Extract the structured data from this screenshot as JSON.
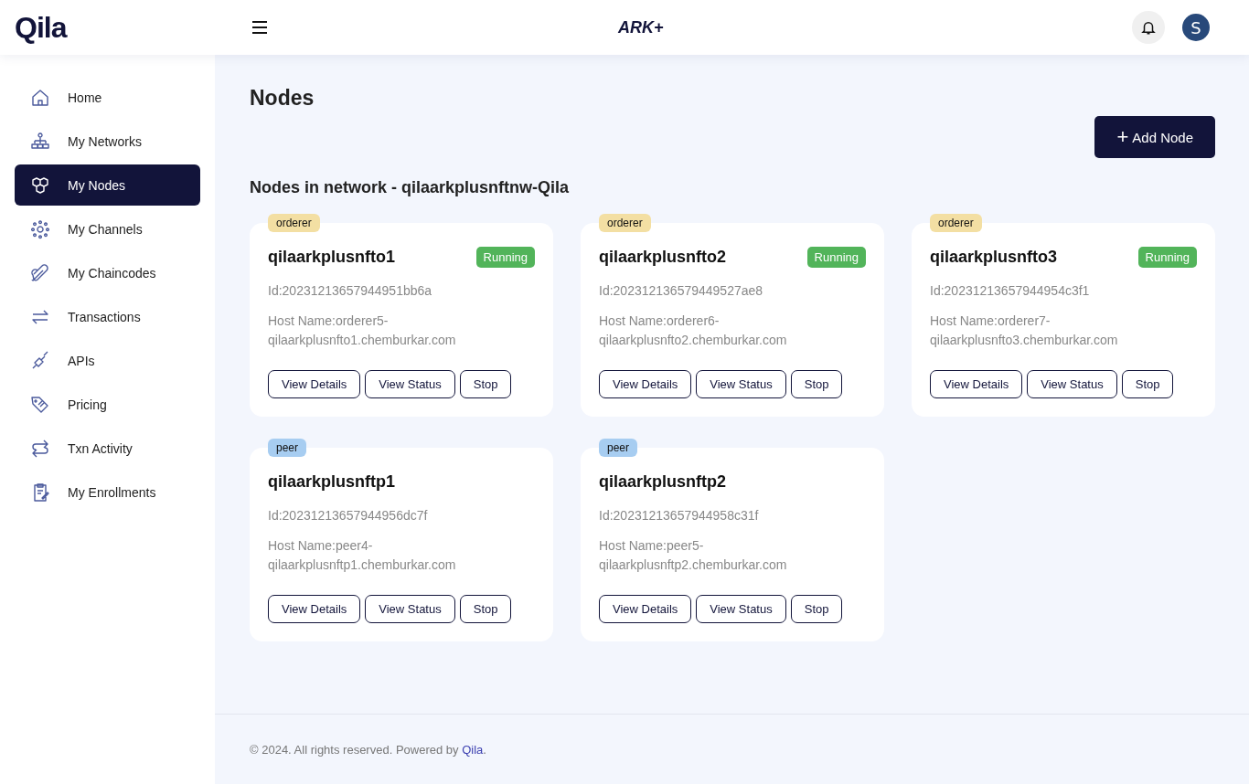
{
  "header": {
    "logo": "Qila",
    "product_logo": "ARK+",
    "avatar": "S"
  },
  "sidebar": {
    "items": [
      {
        "label": "Home",
        "selected": false
      },
      {
        "label": "My Networks",
        "selected": false
      },
      {
        "label": "My Nodes",
        "selected": true
      },
      {
        "label": "My Channels",
        "selected": false
      },
      {
        "label": "My Chaincodes",
        "selected": false
      },
      {
        "label": "Transactions",
        "selected": false
      },
      {
        "label": "APIs",
        "selected": false
      },
      {
        "label": "Pricing",
        "selected": false
      },
      {
        "label": "Txn Activity",
        "selected": false
      },
      {
        "label": "My Enrollments",
        "selected": false
      }
    ]
  },
  "page": {
    "title": "Nodes",
    "add_button": "Add Node",
    "add_icon": "+",
    "subtitle": "Nodes in network - qilaarkplusnftnw-Qila"
  },
  "nodes": [
    {
      "type": "orderer",
      "kind": "orderer",
      "name": "qilaarkplusnfto1",
      "status": "Running",
      "id": "Id:20231213657944951bb6a",
      "host": "Host Name:orderer5-qilaarkplusnfto1.chemburkar.com",
      "buttons": [
        "View Details",
        "View Status",
        "Stop"
      ]
    },
    {
      "type": "orderer",
      "kind": "orderer",
      "name": "qilaarkplusnfto2",
      "status": "Running",
      "id": "Id:202312136579449527ae8",
      "host": "Host Name:orderer6-qilaarkplusnfto2.chemburkar.com",
      "buttons": [
        "View Details",
        "View Status",
        "Stop"
      ]
    },
    {
      "type": "orderer",
      "kind": "orderer",
      "name": "qilaarkplusnfto3",
      "status": "Running",
      "id": "Id:20231213657944954c3f1",
      "host": "Host Name:orderer7-qilaarkplusnfto3.chemburkar.com",
      "buttons": [
        "View Details",
        "View Status",
        "Stop"
      ]
    },
    {
      "type": "peer",
      "kind": "peer",
      "name": "qilaarkplusnftp1",
      "id": "Id:20231213657944956dc7f",
      "host": "Host Name:peer4-qilaarkplusnftp1.chemburkar.com",
      "buttons": [
        "View Details",
        "View Status",
        "Stop"
      ]
    },
    {
      "type": "peer",
      "kind": "peer",
      "name": "qilaarkplusnftp2",
      "id": "Id:20231213657944958c31f",
      "host": "Host Name:peer5-qilaarkplusnftp2.chemburkar.com",
      "buttons": [
        "View Details",
        "View Status",
        "Stop"
      ]
    }
  ],
  "footer": {
    "text": "© 2024. All rights reserved. Powered by",
    "link": "Qila",
    "suffix": "."
  }
}
